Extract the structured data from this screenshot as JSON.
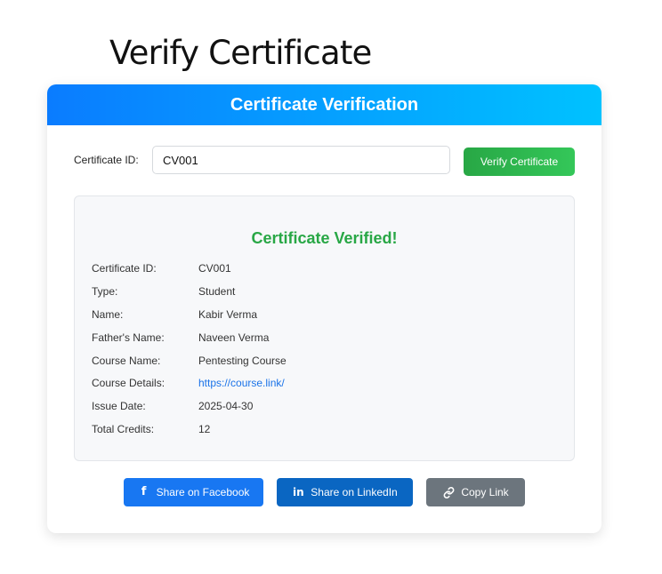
{
  "page": {
    "title": "Verify Certificate"
  },
  "card": {
    "header": "Certificate Verification"
  },
  "form": {
    "label": "Certificate ID:",
    "input_value": "CV001",
    "button_label": "Verify Certificate"
  },
  "result": {
    "status": "Certificate Verified!",
    "rows": [
      {
        "label": "Certificate ID:",
        "value": "CV001"
      },
      {
        "label": "Type:",
        "value": "Student"
      },
      {
        "label": "Name:",
        "value": "Kabir Verma"
      },
      {
        "label": "Father's Name:",
        "value": "Naveen Verma"
      },
      {
        "label": "Course Name:",
        "value": "Pentesting Course"
      },
      {
        "label": "Course Details:",
        "value": "https://course.link/"
      },
      {
        "label": "Issue Date:",
        "value": "2025-04-30"
      },
      {
        "label": "Total Credits:",
        "value": "12"
      }
    ]
  },
  "share": {
    "facebook_label": "Share on Facebook",
    "linkedin_label": "Share on LinkedIn",
    "copy_label": "Copy Link",
    "facebook_icon": "facebook-icon",
    "linkedin_icon": "linkedin-icon",
    "copy_icon": "link-icon"
  },
  "colors": {
    "header_gradient_start": "#0a7cff",
    "header_gradient_end": "#00c2ff",
    "success_green": "#28a745",
    "facebook_blue": "#1877f2",
    "linkedin_blue": "#0a66c2",
    "copy_gray": "#6c757d",
    "link_blue": "#1a73e8"
  }
}
